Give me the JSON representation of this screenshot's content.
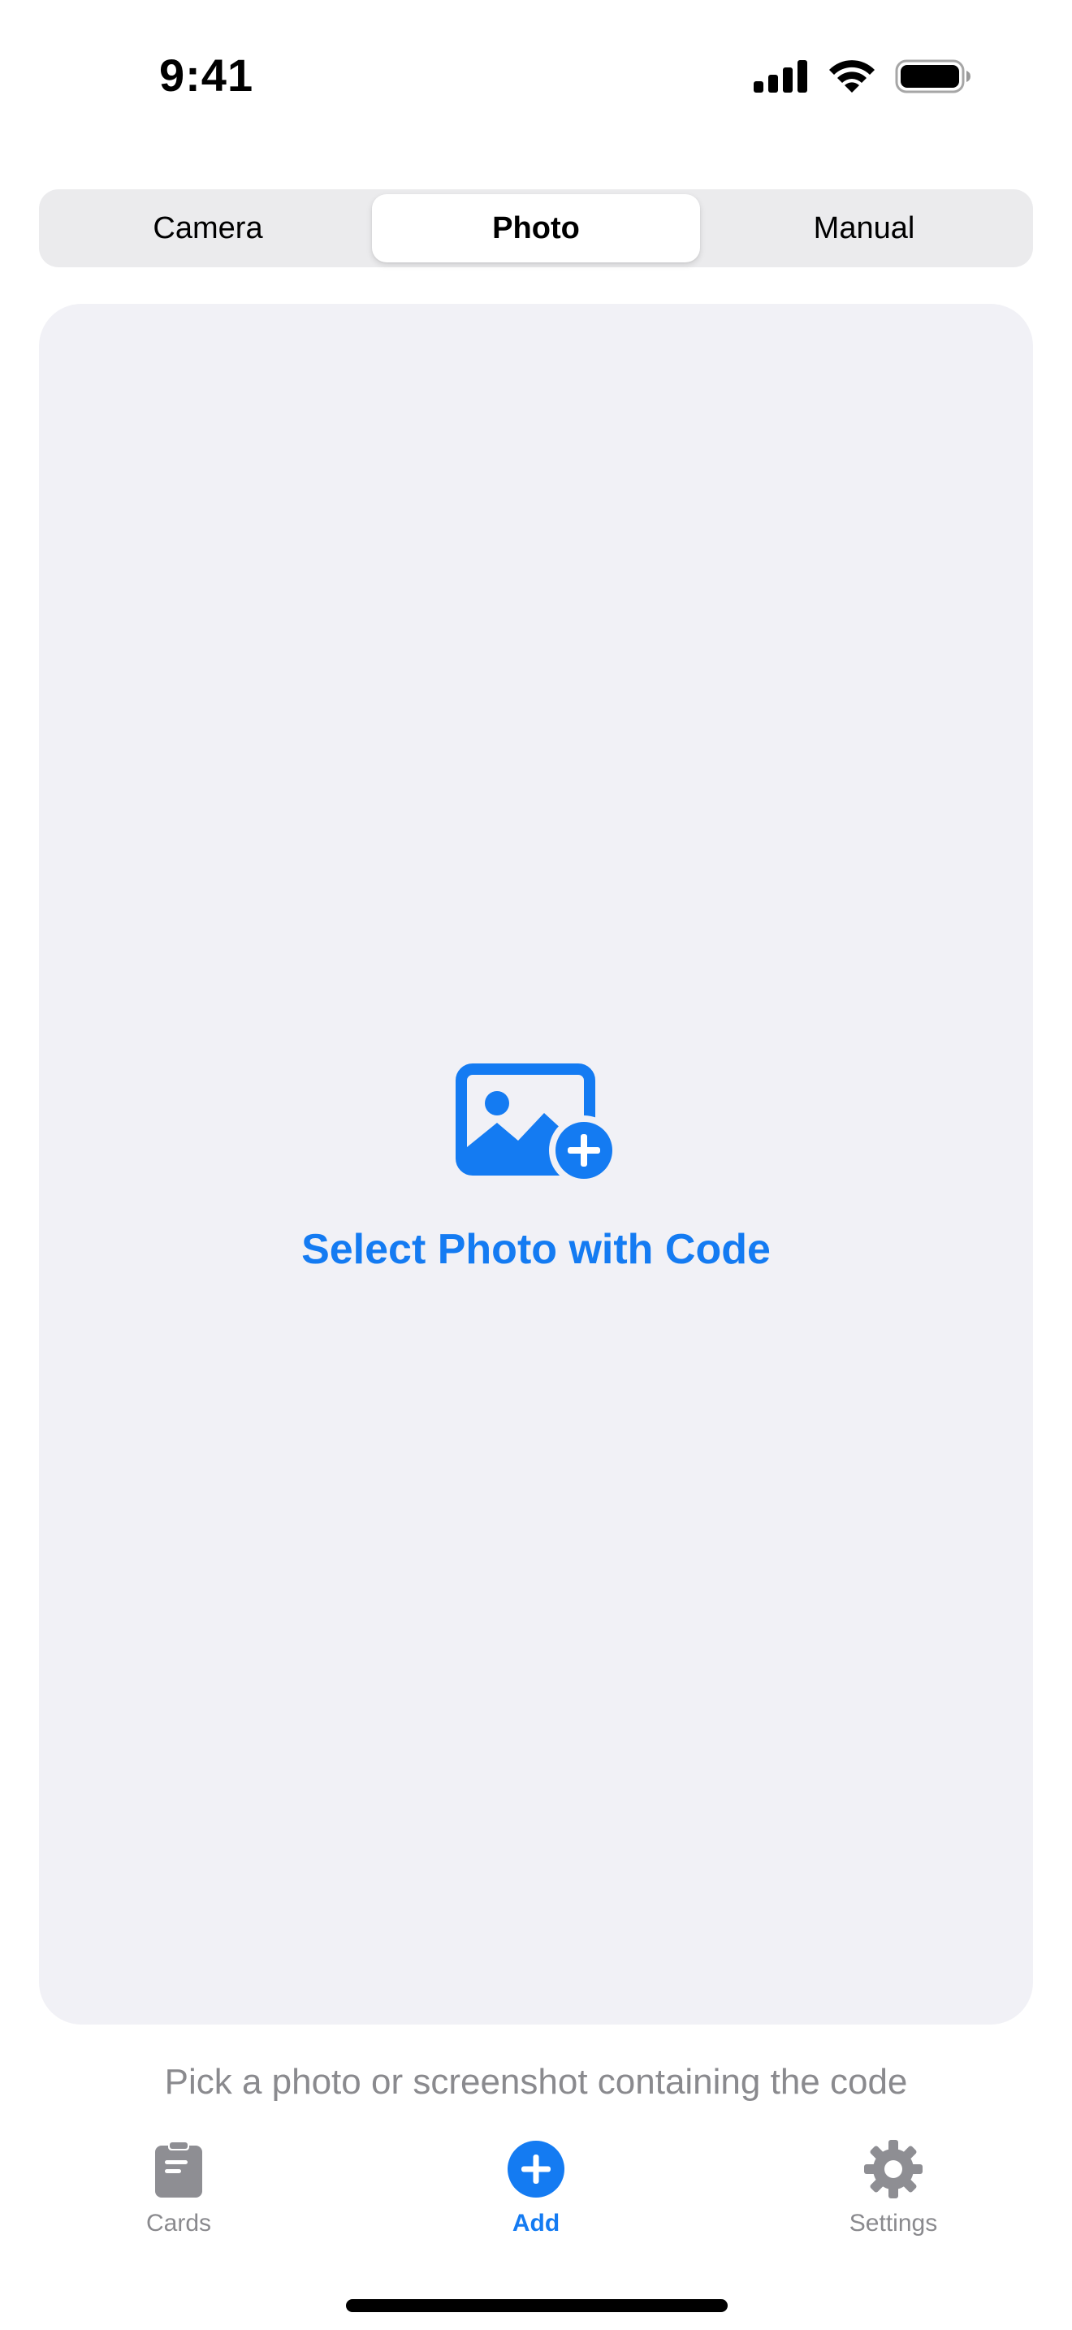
{
  "status_bar": {
    "time": "9:41",
    "icons": [
      "cellular-signal-icon",
      "wifi-icon",
      "battery-icon"
    ]
  },
  "segmented_control": {
    "options": [
      "Camera",
      "Photo",
      "Manual"
    ],
    "selected": "Photo"
  },
  "photo_picker": {
    "icon": "photo-badge-plus-icon",
    "label": "Select Photo with Code"
  },
  "hint": "Pick a photo or screenshot containing the code",
  "tab_bar": {
    "items": [
      {
        "label": "Cards",
        "icon": "clipboard-icon"
      },
      {
        "label": "Add",
        "icon": "plus-circle-icon"
      },
      {
        "label": "Settings",
        "icon": "gear-icon"
      }
    ],
    "selected": "Add"
  },
  "colors": {
    "accent": "#147bf2",
    "secondary_text": "#8a8a8e",
    "card_background": "#f1f1f6",
    "segment_background": "#ebebed",
    "inactive_icon": "#8e8e93"
  }
}
